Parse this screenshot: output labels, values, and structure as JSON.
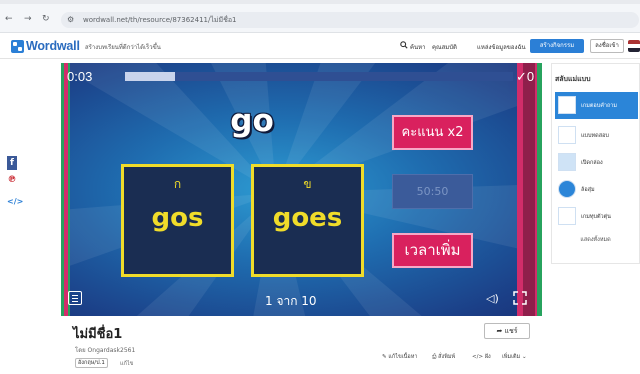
{
  "browser": {
    "url": "wordwall.net/th/resource/87362411/ไม่มีชื่อ1"
  },
  "header": {
    "logo_text": "Wordwall",
    "tagline": "สร้างบทเรียนที่ดีกว่าได้เร็วขึ้น",
    "search_label": "ค้นหา",
    "features_label": "คุณสมบัติ",
    "activities_label": "แหล่งข้อมูลของฉัน",
    "create_label": "สร้างกิจกรรม",
    "login_label": "ลงชื่อเข้า"
  },
  "game": {
    "timer": "0:03",
    "progress": 0.13,
    "score": "✓0",
    "word": "go",
    "answers": [
      {
        "letter": "ก",
        "text": "gos"
      },
      {
        "letter": "ข",
        "text": "goes"
      }
    ],
    "powerups": {
      "double": "คะแนน x2",
      "fifty": "50:50",
      "time": "เวลาเพิ่ม"
    },
    "page_count": "1 จาก 10"
  },
  "templates": {
    "title": "สลับแม่แบบ",
    "items": [
      {
        "label": "เกมตอบคำถาม",
        "selected": true
      },
      {
        "label": "แบบทดสอบ",
        "selected": false
      },
      {
        "label": "เปิดกล่อง",
        "selected": false
      },
      {
        "label": "ล้อสุ่ม",
        "selected": false
      },
      {
        "label": "เกมทุบตัวตุ่น",
        "selected": false
      }
    ],
    "more": "แสดงทั้งหมด"
  },
  "activity": {
    "title": "ไม่มีชื่อ1",
    "author": "โดย Ongardask2561",
    "tag": "อังกฤษ/ป.1",
    "tag_extra": "แก้ไข",
    "share_label": "แชร์",
    "actions": {
      "edit": "แก้ไขเนื้อหา",
      "print": "สั่งพิมพ์",
      "embed": "ฝัง",
      "more": "เพิ่มเติม"
    }
  },
  "colors": {
    "accent": "#2b85d8",
    "answer_border": "#f0dc2a",
    "powerup_pink": "#d9215e"
  }
}
